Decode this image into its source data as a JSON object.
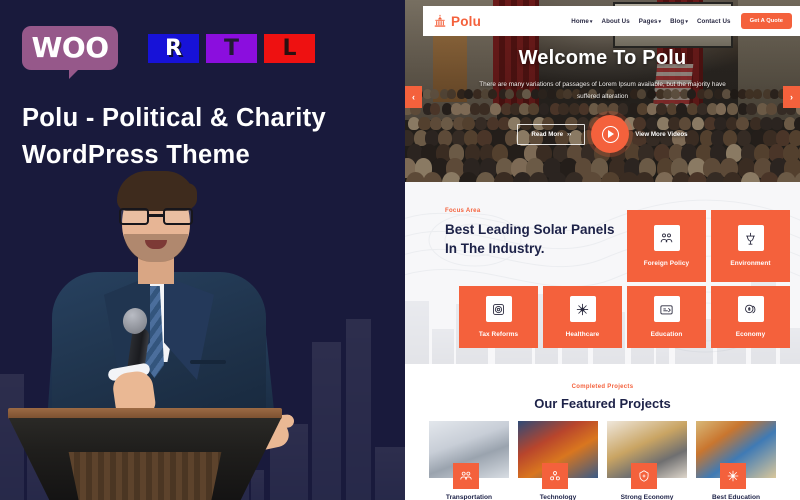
{
  "promo": {
    "badges": [
      {
        "name": "woo",
        "text": "WOO"
      },
      {
        "name": "rtl-r",
        "text": "R"
      },
      {
        "name": "rtl-t",
        "text": "T"
      },
      {
        "name": "rtl-l",
        "text": "L"
      }
    ],
    "title": "Polu - Political & Charity WordPress Theme",
    "background_color": "#191a3c",
    "accent_color": "#f4613c",
    "woo_color": "#96588a",
    "rtl_colors": {
      "r": "#1712d8",
      "t": "#8b0ede",
      "l": "#ee1111"
    }
  },
  "site": {
    "navbar": {
      "logo_icon": "capitol-building-icon",
      "brand": "Polu",
      "links": [
        {
          "label": "Home",
          "has_caret": true
        },
        {
          "label": "About Us",
          "has_caret": false
        },
        {
          "label": "Pages",
          "has_caret": true
        },
        {
          "label": "Blog",
          "has_caret": true
        },
        {
          "label": "Contact Us",
          "has_caret": false
        }
      ],
      "cta": "Get A Quote"
    },
    "hero": {
      "title": "Welcome To Polu",
      "subtitle": "There are many variations of passages of Lorem Ipsum available, but the majority have suffered alteration",
      "button": "Read More",
      "video_text": "View More Videos",
      "prev_arrow": "‹",
      "next_arrow": "›",
      "play_icon": "play-icon"
    },
    "focus": {
      "label": "Focus Area",
      "title": "Best Leading Solar Panels In The Industry.",
      "cards": [
        {
          "label": "Foreign Policy",
          "icon": "policy-icon"
        },
        {
          "label": "Environment",
          "icon": "environment-icon"
        },
        {
          "label": "Tax Reforms",
          "icon": "tax-icon"
        },
        {
          "label": "Healthcare",
          "icon": "healthcare-icon"
        },
        {
          "label": "Education",
          "icon": "education-icon"
        },
        {
          "label": "Economy",
          "icon": "economy-icon"
        }
      ]
    },
    "projects": {
      "label": "Completed Projects",
      "title": "Our Featured Projects",
      "cards": [
        {
          "label": "Transportation",
          "icon": "train-icon"
        },
        {
          "label": "Technology",
          "icon": "gears-icon"
        },
        {
          "label": "Strong Economy",
          "icon": "coins-icon"
        },
        {
          "label": "Best Education",
          "icon": "volunteer-icon"
        }
      ]
    }
  }
}
